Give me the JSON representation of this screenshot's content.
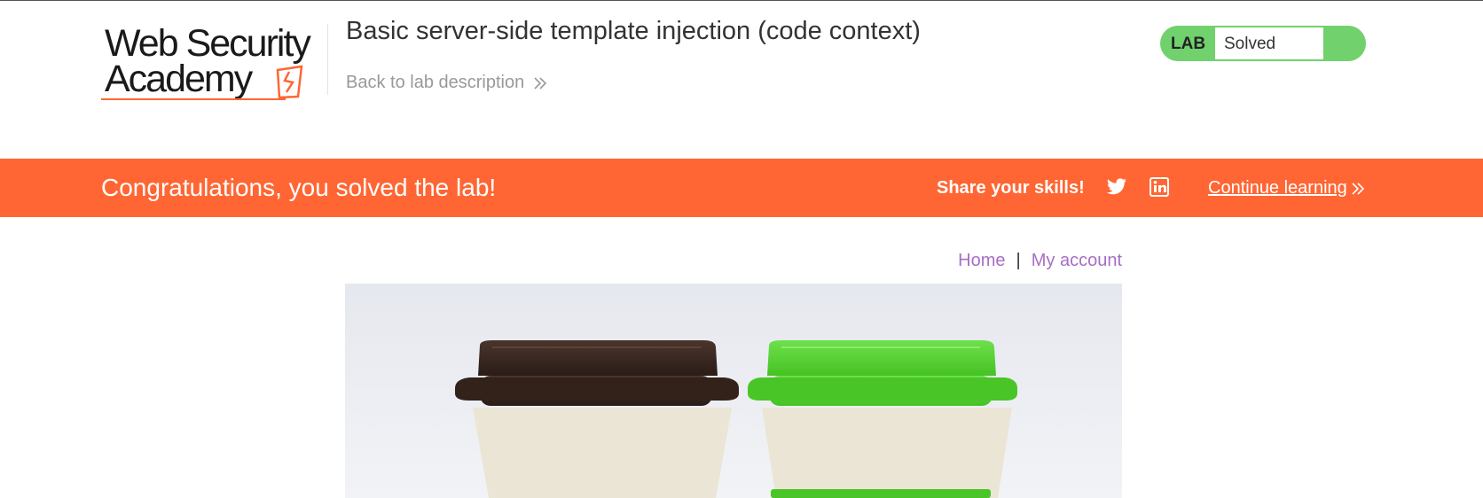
{
  "brand": {
    "line1": "Web Security",
    "line2": "Academy"
  },
  "lab": {
    "title": "Basic server-side template injection (code context)",
    "back_link": "Back to lab description",
    "status_tag": "LAB",
    "status_value": "Solved"
  },
  "banner": {
    "message": "Congratulations, you solved the lab!",
    "share_label": "Share your skills!",
    "continue_label": "Continue learning"
  },
  "nav": {
    "home": "Home",
    "separator": "|",
    "account": "My account"
  },
  "colors": {
    "accent": "#ff6633",
    "status_green": "#70d16d",
    "link_purple": "#a66fc4",
    "cup_brown": "#3d2b24",
    "cup_green": "#5fd43c"
  },
  "icons": [
    "twitter-icon",
    "linkedin-icon",
    "chevron-double-right-icon"
  ]
}
